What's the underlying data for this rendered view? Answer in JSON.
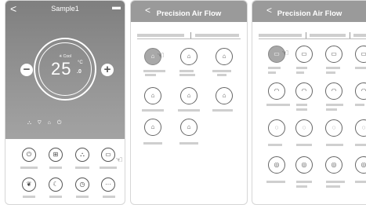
{
  "screen1": {
    "title": "Sample1",
    "back_icon": "chevron-left-icon",
    "more_icon": "more-icon",
    "mode": "✳ Cool",
    "temperature": "25",
    "temperature_decimal": ".0",
    "unit": "°C",
    "minus_label": "−",
    "plus_label": "+",
    "status_icons": "⛬ ♡ ⌂ ⏻",
    "controls": [
      {
        "icon": "power-icon",
        "glyph": "⏻"
      },
      {
        "icon": "mode-icon",
        "glyph": "⊞"
      },
      {
        "icon": "fan-icon",
        "glyph": "⛬"
      },
      {
        "icon": "airflow-icon",
        "glyph": "▭"
      },
      {
        "icon": "eco-icon",
        "glyph": "❦"
      },
      {
        "icon": "sleep-icon",
        "glyph": "☾"
      },
      {
        "icon": "timer-icon",
        "glyph": "◷"
      },
      {
        "icon": "more-options-icon",
        "glyph": "···"
      }
    ]
  },
  "screen2": {
    "title": "Precision Air Flow",
    "back_label": "<",
    "vents": [
      "⌂",
      "⌂",
      "⌂",
      "⌂",
      "⌂",
      "⌂",
      "⌂",
      "⌂"
    ]
  },
  "screen3": {
    "title": "Precision Air Flow",
    "back_label": "<",
    "vents": [
      "▭",
      "▭",
      "▭",
      "▭",
      "◠",
      "◠",
      "◠",
      "◠",
      "◌",
      "◌",
      "◌",
      "◌",
      "◎",
      "◎",
      "◎",
      "◎"
    ]
  },
  "colors": {
    "header": "#9a9a9a",
    "hero_top": "#7f7f7f",
    "hero_bottom": "#a3a3a3"
  }
}
